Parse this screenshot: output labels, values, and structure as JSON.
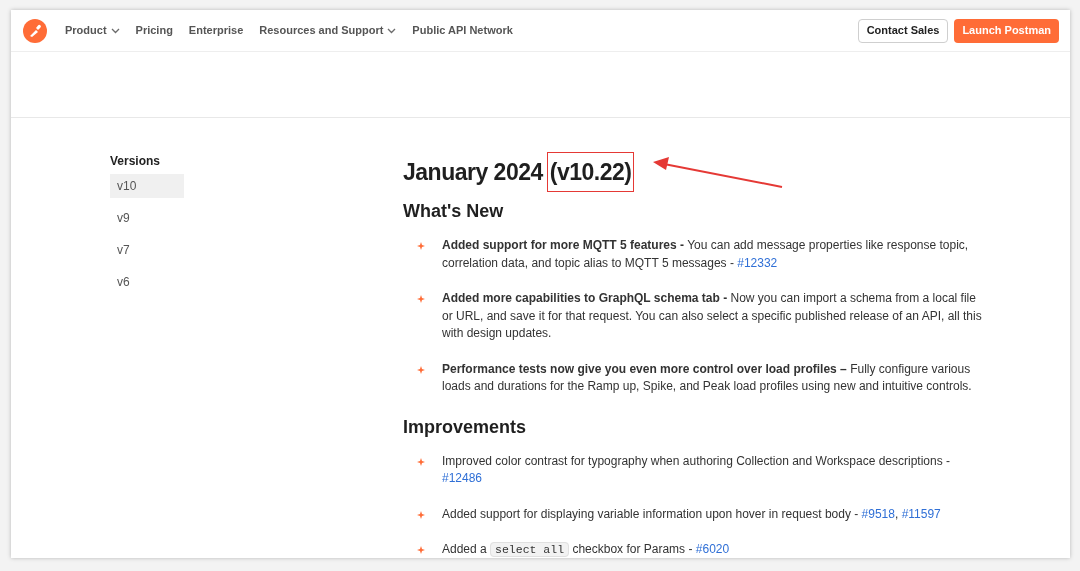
{
  "nav": {
    "items": [
      {
        "label": "Product",
        "dropdown": true
      },
      {
        "label": "Pricing",
        "dropdown": false
      },
      {
        "label": "Enterprise",
        "dropdown": false
      },
      {
        "label": "Resources and Support",
        "dropdown": true
      },
      {
        "label": "Public API Network",
        "dropdown": false
      }
    ],
    "buttons": [
      {
        "label": "Contact Sales",
        "kind": "outline"
      },
      {
        "label": "Launch Postman",
        "kind": "primary"
      }
    ]
  },
  "sidebar": {
    "title": "Versions",
    "items": [
      {
        "label": "v10",
        "selected": true
      },
      {
        "label": "v9",
        "selected": false
      },
      {
        "label": "v7",
        "selected": false
      },
      {
        "label": "v6",
        "selected": false
      }
    ]
  },
  "release": {
    "title": "January 2024",
    "version": "(v10.22)",
    "annotated": true,
    "sections": [
      {
        "title": "What's New",
        "items": [
          {
            "parts": [
              {
                "kind": "text",
                "text": "**Added support for more MQTT 5 features -** You can add message properties like response topic, correlation data, and topic alias to MQTT 5 messages - "
              },
              {
                "kind": "link",
                "text": "#12332"
              }
            ]
          },
          {
            "parts": [
              {
                "kind": "text",
                "text": "**Added more capabilities to GraphQL schema tab -** Now you can import a schema from a local file or URL, and save it for that request. You can also select a specific published release of an API, all this with design updates."
              }
            ]
          },
          {
            "parts": [
              {
                "kind": "text",
                "text": "**Performance tests now give you even more control over load profiles –** Fully configure various loads and durations for the Ramp up, Spike, and Peak load profiles using new and intuitive controls."
              }
            ]
          }
        ]
      },
      {
        "title": "Improvements",
        "items": [
          {
            "parts": [
              {
                "kind": "text",
                "text": "Improved color contrast for typography when authoring Collection and Workspace descriptions - "
              },
              {
                "kind": "link",
                "text": "#12486"
              }
            ]
          },
          {
            "parts": [
              {
                "kind": "text",
                "text": "Added support for displaying variable information upon hover in request body - "
              },
              {
                "kind": "link",
                "text": "#9518"
              },
              {
                "kind": "text",
                "text": ", "
              },
              {
                "kind": "link",
                "text": "#11597"
              }
            ]
          },
          {
            "parts": [
              {
                "kind": "text",
                "text": "Added a "
              },
              {
                "kind": "code",
                "text": "select all"
              },
              {
                "kind": "text",
                "text": " checkbox for Params - "
              },
              {
                "kind": "link",
                "text": "#6020"
              }
            ]
          }
        ]
      }
    ]
  }
}
